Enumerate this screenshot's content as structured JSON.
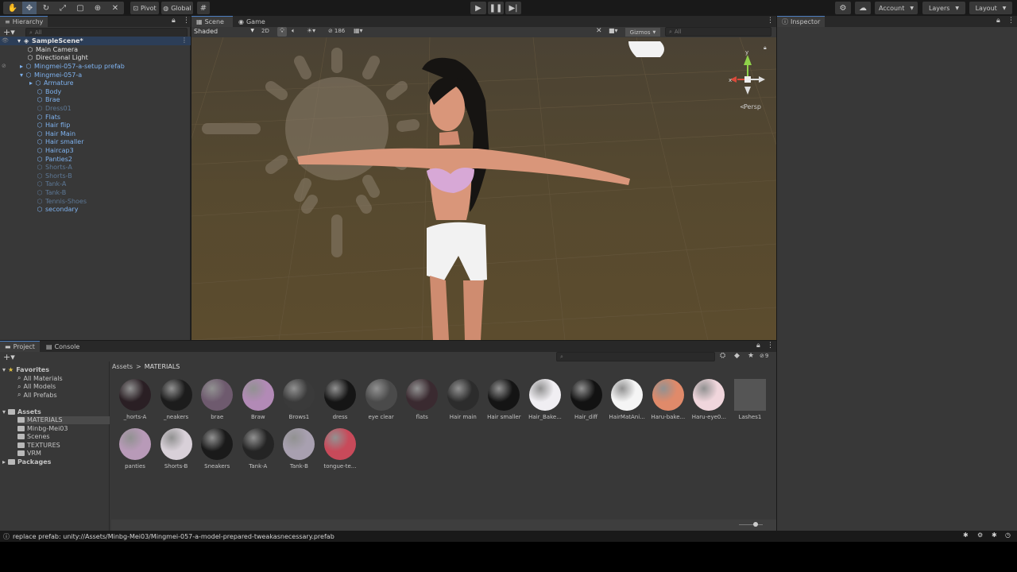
{
  "toolbar": {
    "pivot_label": "Pivot",
    "global_label": "Global",
    "account_label": "Account",
    "layers_label": "Layers",
    "layout_label": "Layout"
  },
  "hierarchy": {
    "tab": "Hierarchy",
    "search_placeholder": "All",
    "scene_name": "SampleScene*",
    "items": [
      {
        "label": "Main Camera",
        "style": "white"
      },
      {
        "label": "Directional Light",
        "style": "white"
      },
      {
        "label": "Mingmei-057-a-setup prefab",
        "style": "blue"
      },
      {
        "label": "Mingmei-057-a",
        "style": "blue"
      },
      {
        "label": "Armature",
        "style": "blue"
      },
      {
        "label": "Body",
        "style": "blue"
      },
      {
        "label": "Brae",
        "style": "blue"
      },
      {
        "label": "Dress01",
        "style": "dim"
      },
      {
        "label": "Flats",
        "style": "blue"
      },
      {
        "label": "Hair flip",
        "style": "blue"
      },
      {
        "label": "Hair Main",
        "style": "blue"
      },
      {
        "label": "Hair smaller",
        "style": "blue"
      },
      {
        "label": "Haircap3",
        "style": "blue"
      },
      {
        "label": "Panties2",
        "style": "blue"
      },
      {
        "label": "Shorts-A",
        "style": "dim"
      },
      {
        "label": "Shorts-B",
        "style": "dim"
      },
      {
        "label": "Tank-A",
        "style": "dim"
      },
      {
        "label": "Tank-B",
        "style": "dim"
      },
      {
        "label": "Tennis-Shoes",
        "style": "dim"
      },
      {
        "label": "secondary",
        "style": "blue"
      }
    ]
  },
  "scene": {
    "tab_scene": "Scene",
    "tab_game": "Game",
    "shading_mode": "Shaded",
    "mode_2d": "2D",
    "hidden_count": "186",
    "gizmos_label": "Gizmos",
    "search_placeholder": "All",
    "persp_label": "Persp",
    "axis_x": "x",
    "axis_y": "y"
  },
  "inspector": {
    "tab": "Inspector"
  },
  "project": {
    "tab_project": "Project",
    "tab_console": "Console",
    "breadcrumb_root": "Assets",
    "breadcrumb_sep": ">",
    "breadcrumb_current": "MATERIALS",
    "filter_count": "9",
    "tree": [
      {
        "label": "Favorites",
        "bold": true
      },
      {
        "label": "All Materials"
      },
      {
        "label": "All Models"
      },
      {
        "label": "All Prefabs"
      },
      {
        "label": "Assets",
        "bold": true
      },
      {
        "label": "MATERIALS"
      },
      {
        "label": "Minbg-Mei03"
      },
      {
        "label": "Scenes"
      },
      {
        "label": "TEXTURES"
      },
      {
        "label": "VRM"
      },
      {
        "label": "Packages",
        "bold": true
      }
    ],
    "assets": [
      {
        "label": "_horts-A",
        "color": "#2a1f24"
      },
      {
        "label": "_neakers",
        "color": "#1c1c1c"
      },
      {
        "label": "brae",
        "color": "#6e5a6e"
      },
      {
        "label": "Braw",
        "color": "#b28ab6"
      },
      {
        "label": "Brows1",
        "color": "#3a3a3a"
      },
      {
        "label": "dress",
        "color": "#151515"
      },
      {
        "label": "eye clear",
        "color": "#4a4a4a"
      },
      {
        "label": "flats",
        "color": "#3a2a30"
      },
      {
        "label": "Hair main",
        "color": "#2c2c2c"
      },
      {
        "label": "Hair smaller",
        "color": "#141414"
      },
      {
        "label": "Hair_Bake...",
        "color": "#f0eef2"
      },
      {
        "label": "Hair_diff",
        "color": "#121212"
      },
      {
        "label": "HairMatAni...",
        "color": "#f5f5f5"
      },
      {
        "label": "Haru-bake...",
        "color": "#e08a6a"
      },
      {
        "label": "Haru-eye0...",
        "color": "#f0d6dc"
      },
      {
        "label": "Lashes1",
        "color": "#555555"
      },
      {
        "label": "panties",
        "color": "#b89ab8"
      },
      {
        "label": "Shorts-B",
        "color": "#d8d0d8"
      },
      {
        "label": "Sneakers",
        "color": "#1a1a1a"
      },
      {
        "label": "Tank-A",
        "color": "#242424"
      },
      {
        "label": "Tank-B",
        "color": "#a8a0b0"
      },
      {
        "label": "tongue-te...",
        "color": "#c84a5a"
      }
    ]
  },
  "status": {
    "message": "replace prefab: unity://Assets/Minbg-Mei03/Mingmei-057-a-model-prepared-tweakasnecessary.prefab"
  }
}
